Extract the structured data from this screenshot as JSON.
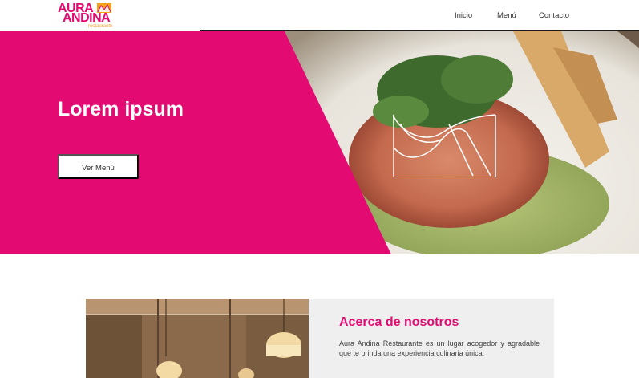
{
  "brand": {
    "name_line1": "AURA",
    "name_line2": "ANDINA",
    "tagline": "restaurante",
    "logo_mark_icon": "mountain-crest-icon"
  },
  "nav": {
    "items": [
      {
        "label": "Inicio"
      },
      {
        "label": "Menú"
      },
      {
        "label": "Contacto"
      }
    ]
  },
  "hero": {
    "title": "Lorem ipsum",
    "button_label": "Ver Menú",
    "emblem_icon": "aura-andina-emblem-icon"
  },
  "about": {
    "title": "Acerca de nosotros",
    "text": "Aura Andina Restaurante es un lugar acogedor y agradable que te brinda una experiencia culinaria única."
  },
  "colors": {
    "brand_pink": "#e30a72",
    "brand_orange": "#f3a21a",
    "card_bg": "#efefef"
  }
}
